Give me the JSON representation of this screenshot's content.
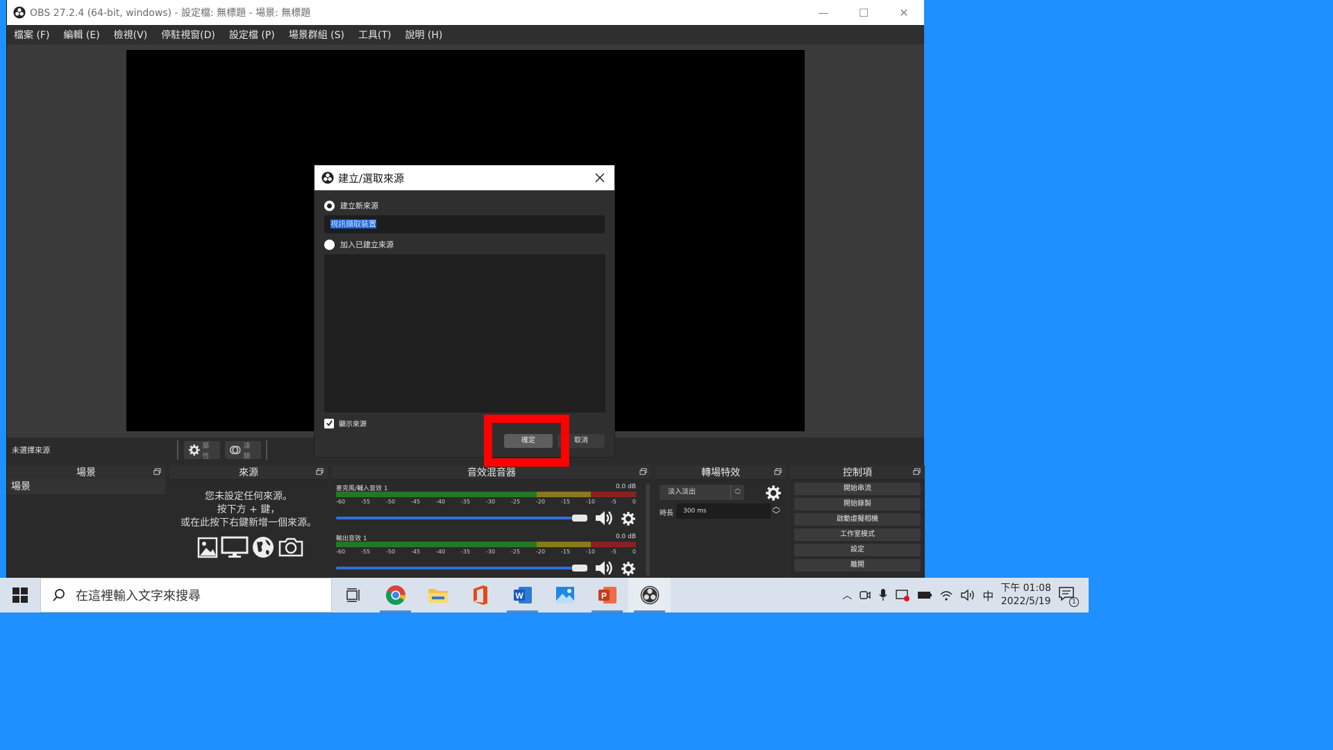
{
  "window": {
    "title": "OBS 27.2.4 (64-bit, windows) - 設定檔: 無標題 - 場景: 無標題"
  },
  "menu": [
    "檔案 (F)",
    "編輯 (E)",
    "檢視(V)",
    "停駐視窗(D)",
    "設定檔 (P)",
    "場景群組 (S)",
    "工具(T)",
    "說明 (H)"
  ],
  "source_toolbar": {
    "no_source": "未選擇來源",
    "properties": "屬性",
    "filters": "濾鏡"
  },
  "docks": {
    "scenes": {
      "title": "場景",
      "items": [
        "場景"
      ]
    },
    "sources": {
      "title": "來源",
      "empty_line1": "您未設定任何來源。",
      "empty_line2": "按下方 + 鍵，",
      "empty_line3": "或在此按下右鍵新增一個來源。"
    },
    "mixer": {
      "title": "音效混音器",
      "tracks": [
        {
          "name": "麥克風/輔入音效 1",
          "db": "0.0 dB"
        },
        {
          "name": "輸出音效 1",
          "db": "0.0 dB"
        }
      ],
      "ticks": [
        "-60",
        "-55",
        "-50",
        "-45",
        "-40",
        "-35",
        "-30",
        "-25",
        "-20",
        "-15",
        "-10",
        "-5",
        "0"
      ]
    },
    "transitions": {
      "title": "轉場特效",
      "selected": "淡入淡出",
      "duration_label": "時長",
      "duration_value": "300 ms"
    },
    "controls": {
      "title": "控制項",
      "buttons": [
        "開始串流",
        "開始錄製",
        "啟動虛擬相機",
        "工作室模式",
        "設定",
        "離開"
      ]
    }
  },
  "dialog": {
    "title": "建立/選取來源",
    "create_new_label": "建立新來源",
    "new_name_value": "視訊擷取裝置",
    "add_existing_label": "加入已建立來源",
    "make_visible_label": "顯示來源",
    "ok": "確定",
    "cancel": "取消"
  },
  "taskbar": {
    "search_placeholder": "在這裡輸入文字來搜尋",
    "ime": "中",
    "time": "下午 01:08",
    "date": "2022/5/19",
    "notification_count": "1"
  },
  "colors": {
    "highlight": "#ff0000",
    "desktop": "#1e90ff",
    "slider": "#2f6fdc"
  }
}
